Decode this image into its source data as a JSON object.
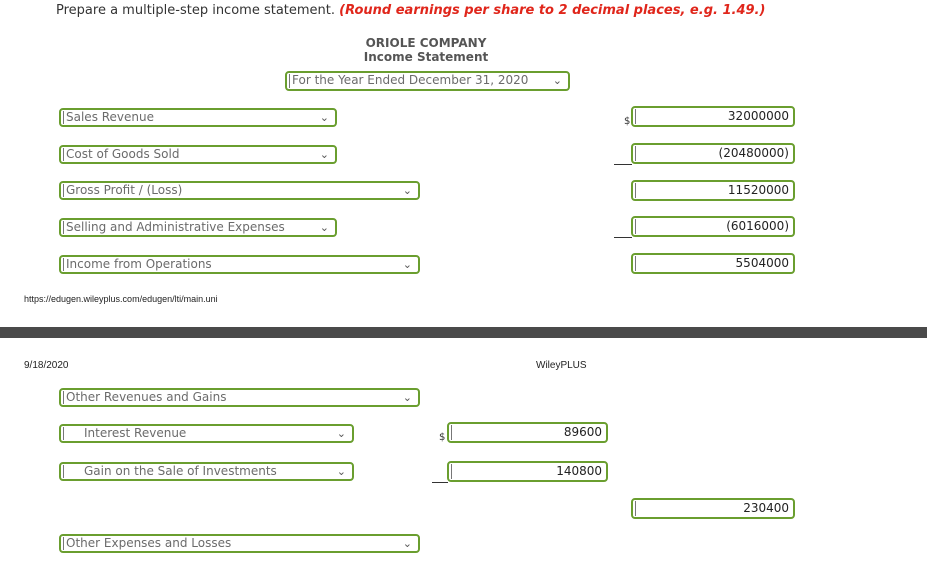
{
  "instructions": {
    "text": "Prepare a multiple-step income statement.",
    "note": "(Round earnings per share to 2 decimal places, e.g. 1.49.)"
  },
  "header": {
    "company": "ORIOLE COMPANY",
    "statement": "Income Statement",
    "period": "For the Year Ended December 31, 2020"
  },
  "rows": {
    "sales_revenue": {
      "label": "Sales Revenue",
      "amount": "32000000"
    },
    "cost_of_goods_sold": {
      "label": "Cost of Goods Sold",
      "amount": "(20480000)"
    },
    "gross_profit": {
      "label": "Gross Profit / (Loss)",
      "amount": "11520000"
    },
    "selling_admin": {
      "label": "Selling and Administrative Expenses",
      "amount": "(6016000)"
    },
    "income_operations": {
      "label": "Income from Operations",
      "amount": "5504000"
    },
    "other_revenues": {
      "label": "Other Revenues and Gains"
    },
    "interest_revenue": {
      "label": "Interest Revenue",
      "amount": "89600"
    },
    "gain_investments": {
      "label": "Gain on the Sale of Investments",
      "amount": "140800"
    },
    "other_total": {
      "amount": "230400"
    },
    "other_expenses": {
      "label": "Other Expenses and Losses"
    }
  },
  "symbols": {
    "dollar": "$"
  },
  "footer": {
    "url": "https://edugen.wileyplus.com/edugen/lti/main.uni",
    "date": "9/18/2020",
    "brand": "WileyPLUS"
  },
  "colors": {
    "accent_border": "#6a9e2f",
    "note_red": "#e0261b"
  }
}
